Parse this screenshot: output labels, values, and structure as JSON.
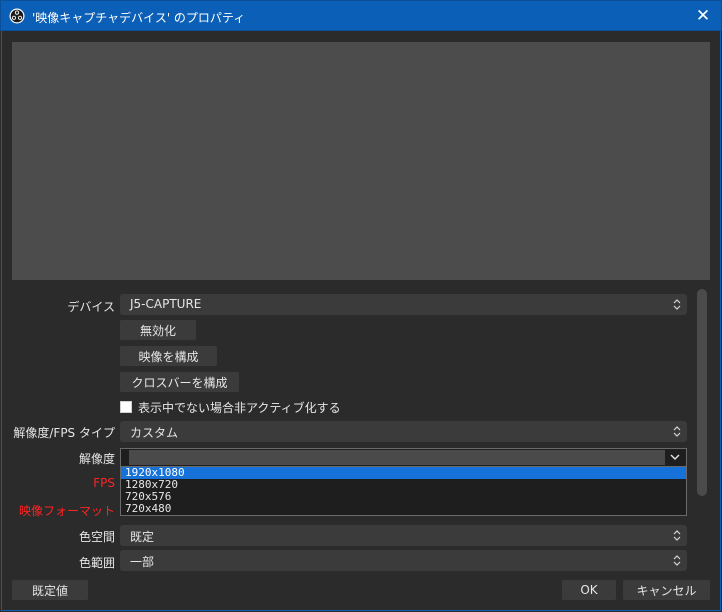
{
  "window": {
    "title": "'映像キャプチャデバイス' のプロパティ",
    "close_glyph": "✕",
    "app_icon": "obs-icon"
  },
  "form": {
    "device": {
      "label": "デバイス",
      "value": "J5-CAPTURE"
    },
    "buttons": {
      "deactivate": "無効化",
      "configure_video": "映像を構成",
      "configure_crossbar": "クロスバーを構成"
    },
    "deactivate_hidden": {
      "label": "表示中でない場合非アクティブ化する",
      "checked": false
    },
    "res_fps_type": {
      "label": "解像度/FPS タイプ",
      "value": "カスタム"
    },
    "resolution": {
      "label": "解像度",
      "value": "",
      "options": [
        "1920x1080",
        "1280x720",
        "720x576",
        "720x480"
      ],
      "selected_index": 0
    },
    "fps": {
      "label": "FPS"
    },
    "video_format": {
      "label": "映像フォーマット"
    },
    "color_space": {
      "label": "色空間",
      "value": "既定"
    },
    "color_range": {
      "label": "色範囲",
      "value": "一部"
    }
  },
  "footer": {
    "defaults": "既定値",
    "ok": "OK",
    "cancel": "キャンセル"
  },
  "colors": {
    "titlebar": "#0b5fb6",
    "background": "#2b2b2b",
    "preview": "#4c4c4c",
    "control": "#3b3b3b",
    "warning_label": "#ff2323",
    "selection": "#1672d8"
  }
}
